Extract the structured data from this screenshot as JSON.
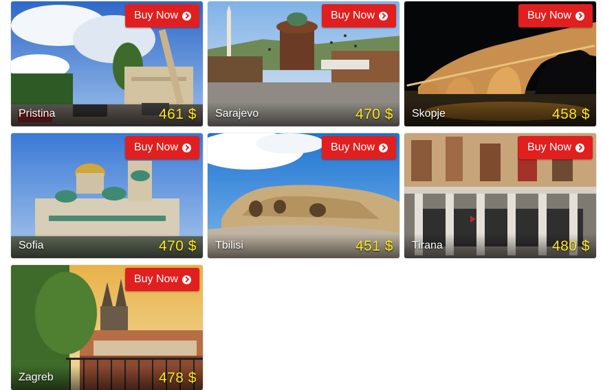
{
  "cards": [
    {
      "city": "Pristina",
      "price": "461 $",
      "button": "Buy Now"
    },
    {
      "city": "Sarajevo",
      "price": "470 $",
      "button": "Buy Now"
    },
    {
      "city": "Skopje",
      "price": "458 $",
      "button": "Buy Now"
    },
    {
      "city": "Sofia",
      "price": "470 $",
      "button": "Buy Now"
    },
    {
      "city": "Tbilisi",
      "price": "451 $",
      "button": "Buy Now"
    },
    {
      "city": "Tirana",
      "price": "480 $",
      "button": "Buy Now"
    },
    {
      "city": "Zagreb",
      "price": "478 $",
      "button": "Buy Now"
    }
  ],
  "icons": {
    "button_icon": "chevron-circle-right-icon"
  },
  "colors": {
    "button_bg": "#e11f1f",
    "price_text": "#ffe81a",
    "city_text": "#ffffff"
  }
}
